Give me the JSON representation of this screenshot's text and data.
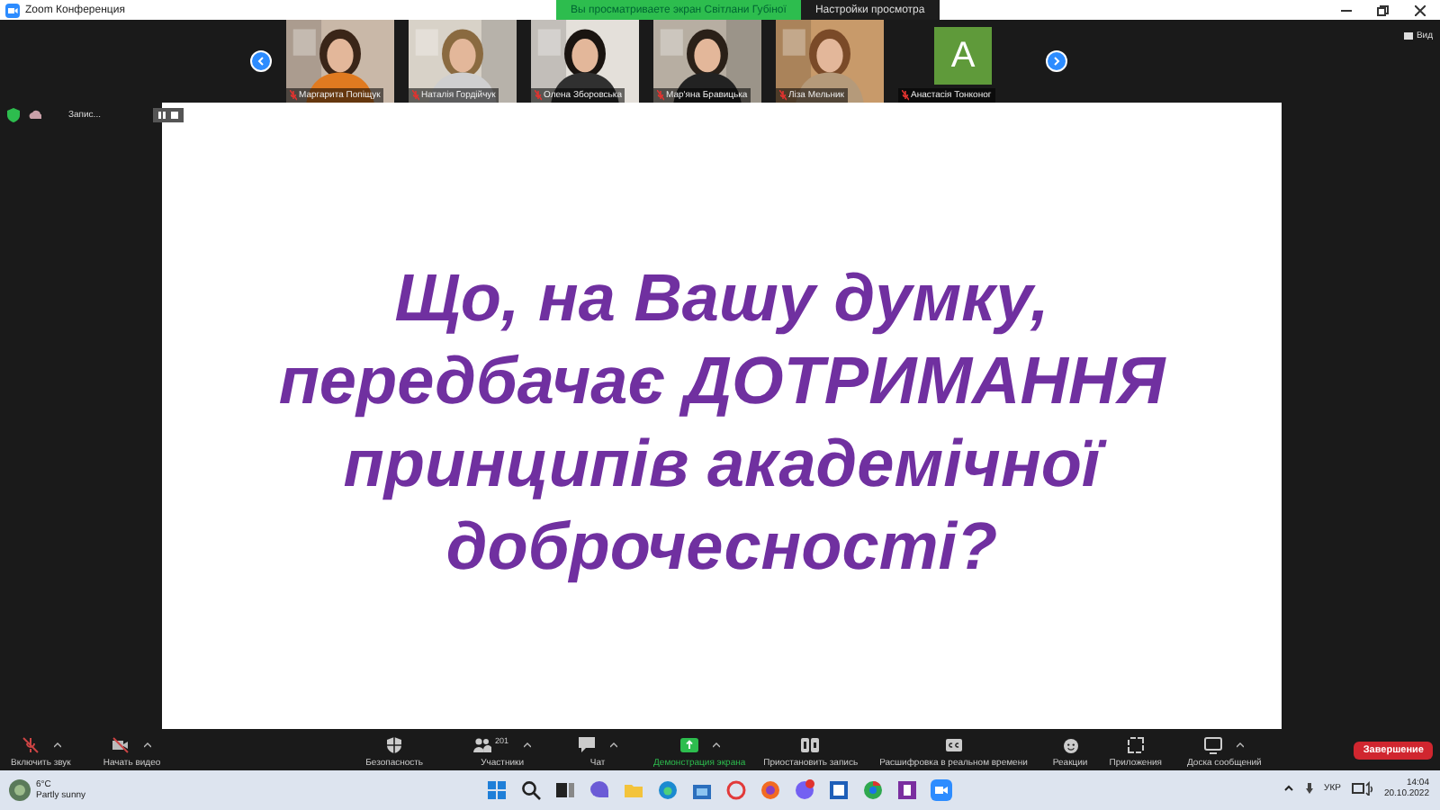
{
  "window": {
    "title": "Zoom Конференция"
  },
  "banner": {
    "text": "Вы просматриваете экран Світлани Губіної",
    "view_menu": "Настройки просмотра"
  },
  "view_button": "Вид",
  "participants": [
    {
      "name": "Маргарита Попіщук",
      "kind": "video"
    },
    {
      "name": "Наталія Гордійчук",
      "kind": "video"
    },
    {
      "name": "Олена Зборовська",
      "kind": "video"
    },
    {
      "name": "Мар'яна Бравицька",
      "kind": "video"
    },
    {
      "name": "Ліза Мельник",
      "kind": "video"
    },
    {
      "name": "Анастасія Тонконог",
      "kind": "avatar",
      "initial": "A"
    }
  ],
  "recording": {
    "label": "Запис..."
  },
  "slide": {
    "lines": [
      "Що, на Вашу думку,",
      "передбачає ДОТРИМАННЯ",
      "принципів академічної",
      "доброчесності?"
    ]
  },
  "toolbar": [
    {
      "label": "Включить звук",
      "menu": true,
      "active": false
    },
    {
      "label": "Начать видео",
      "menu": true,
      "active": false
    },
    {
      "label": "Безопасность",
      "menu": false,
      "active": false
    },
    {
      "label": "Участники",
      "count": "201",
      "menu": true,
      "active": false
    },
    {
      "label": "Чат",
      "menu": true,
      "active": false
    },
    {
      "label": "Демонстрация экрана",
      "menu": true,
      "active": true
    },
    {
      "label": "Приостановить запись",
      "menu": false,
      "active": false
    },
    {
      "label": "Расшифровка в реальном времени",
      "menu": false,
      "active": false
    },
    {
      "label": "Реакции",
      "menu": false,
      "active": false
    },
    {
      "label": "Приложения",
      "menu": false,
      "active": false
    },
    {
      "label": "Доска сообщений",
      "menu": true,
      "active": false
    }
  ],
  "end_button": "Завершение",
  "taskbar": {
    "weather": {
      "temp": "6°C",
      "text": "Partly sunny"
    },
    "language": "УКР",
    "time": "14:04",
    "date": "20.10.2022"
  }
}
